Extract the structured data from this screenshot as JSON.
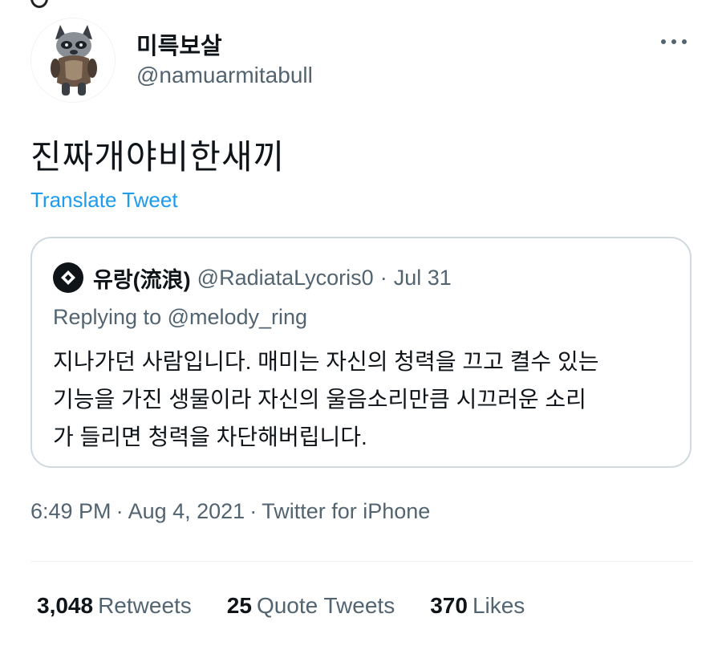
{
  "author": {
    "display_name": "미륵보살",
    "handle": "@namuarmitabull",
    "avatar_icon": "raccoon-figure-avatar"
  },
  "menu": {
    "icon": "more-horizontal-icon"
  },
  "tweet": {
    "text": "진짜개야비한새끼",
    "translate_label": "Translate Tweet"
  },
  "quoted_tweet": {
    "display_name": "유랑(流浪)",
    "handle": "@RadiataLycoris0",
    "separator": "·",
    "date": "Jul 31",
    "replying_to": "Replying to @melody_ring",
    "body_lines": [
      "지나가던 사람입니다. 매미는 자신의 청력을 끄고 켤수 있는",
      "기능을 가진 생물이라 자신의 울음소리만큼 시끄러운 소리",
      "가 들리면 청력을 차단해버립니다."
    ]
  },
  "meta": {
    "time": "6:49 PM",
    "separator": "·",
    "date": "Aug 4, 2021",
    "source": "Twitter for iPhone"
  },
  "stats": [
    {
      "count": "3,048",
      "label": "Retweets"
    },
    {
      "count": "25",
      "label": "Quote Tweets"
    },
    {
      "count": "370",
      "label": "Likes"
    }
  ],
  "colors": {
    "link": "#1d9bf0",
    "secondary_text": "#536471",
    "primary_text": "#0f1419",
    "border": "#cfd9de"
  }
}
